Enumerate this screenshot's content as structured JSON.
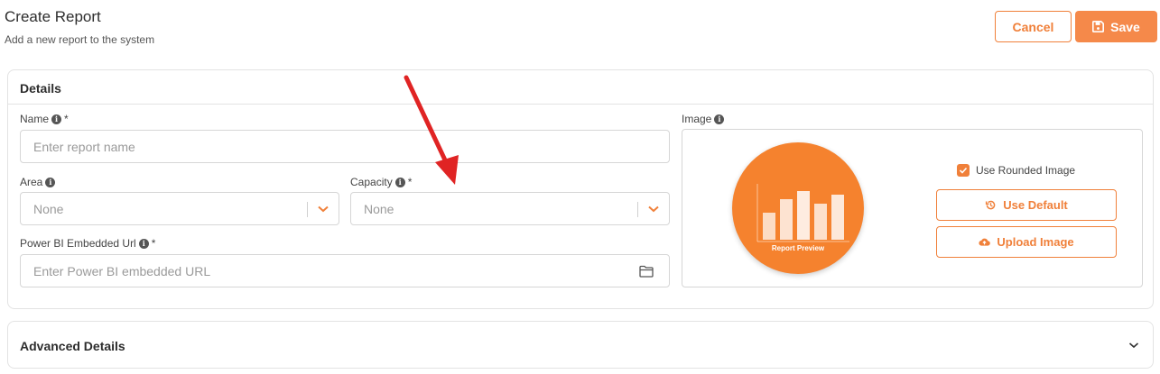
{
  "header": {
    "title": "Create Report",
    "subtitle": "Add a new report to the system",
    "cancel_label": "Cancel",
    "save_label": "Save"
  },
  "details": {
    "title": "Details",
    "name": {
      "label": "Name",
      "required": "*",
      "placeholder": "Enter report name"
    },
    "area": {
      "label": "Area",
      "value": "None"
    },
    "capacity": {
      "label": "Capacity",
      "required": "*",
      "value": "None"
    },
    "powerbi": {
      "label": "Power BI Embedded Url",
      "required": "*",
      "placeholder": "Enter Power BI embedded URL"
    },
    "image": {
      "label": "Image",
      "preview_label": "Report Preview",
      "use_rounded_label": "Use Rounded Image",
      "use_rounded_checked": true,
      "use_default_label": "Use Default",
      "upload_label": "Upload Image"
    }
  },
  "advanced": {
    "title": "Advanced Details"
  },
  "colors": {
    "accent": "#f0803a",
    "preview_bg": "#f5822e",
    "annotation_arrow": "#e02424"
  }
}
